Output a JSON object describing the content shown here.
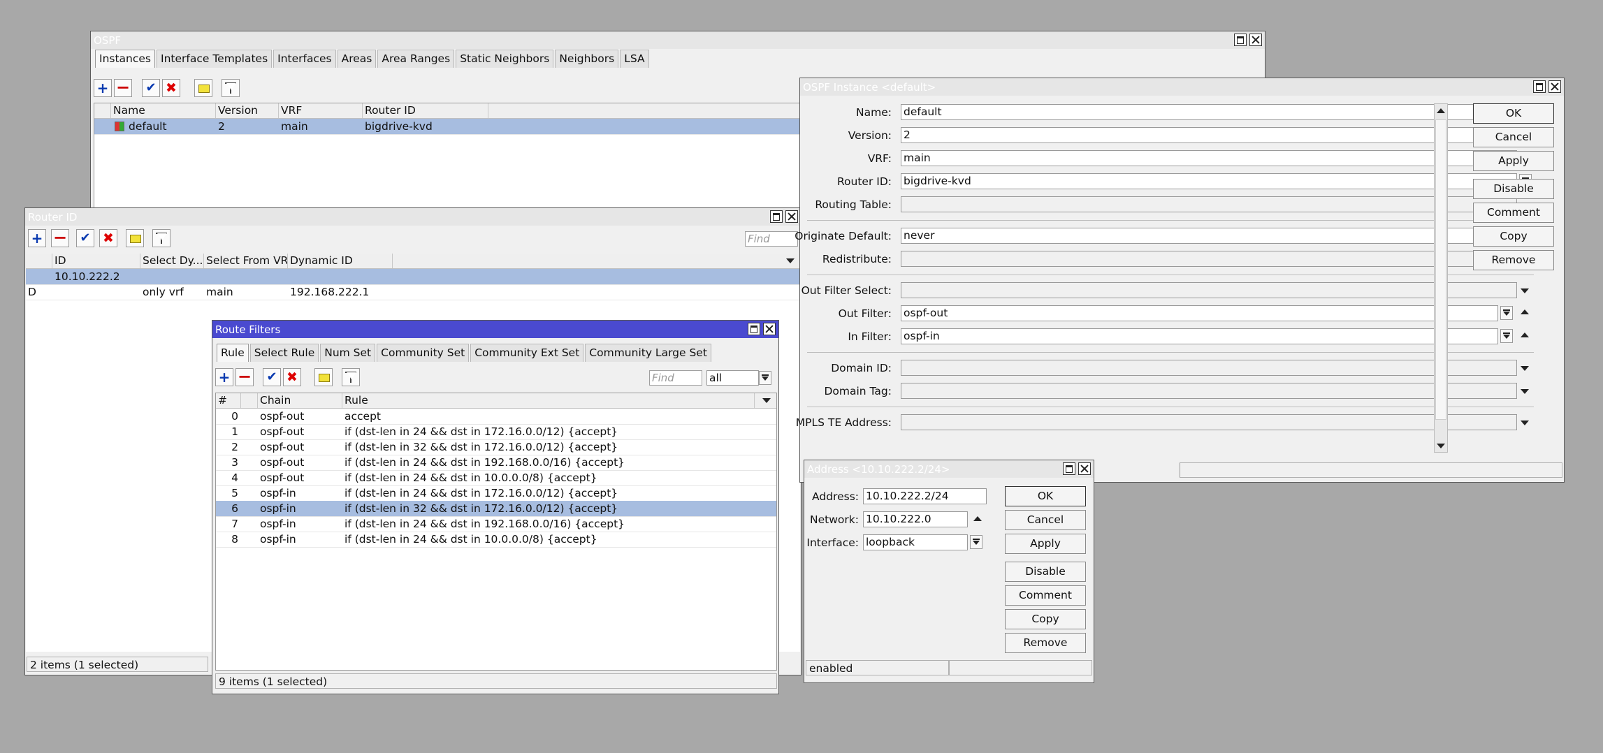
{
  "ospf": {
    "title": "OSPF",
    "tabs": [
      "Instances",
      "Interface Templates",
      "Interfaces",
      "Areas",
      "Area Ranges",
      "Static Neighbors",
      "Neighbors",
      "LSA"
    ],
    "columns": [
      "Name",
      "Version",
      "VRF",
      "Router ID"
    ],
    "rows": [
      {
        "name": "default",
        "version": "2",
        "vrf": "main",
        "router_id": "bigdrive-kvd"
      }
    ]
  },
  "router_id": {
    "title": "Router ID",
    "find_placeholder": "Find",
    "columns": [
      "ID",
      "Select Dy...",
      "Select From VRF",
      "Dynamic ID"
    ],
    "rows": [
      {
        "flag": "",
        "id": "10.10.222.2",
        "select_dy": "",
        "select_vrf": "",
        "dynamic_id": ""
      },
      {
        "flag": "D",
        "id": "",
        "select_dy": "only vrf",
        "select_vrf": "main",
        "dynamic_id": "192.168.222.1"
      }
    ],
    "status": "2 items (1 selected)"
  },
  "route_filters": {
    "title": "Route Filters",
    "tabs": [
      "Rule",
      "Select Rule",
      "Num Set",
      "Community Set",
      "Community Ext Set",
      "Community Large Set"
    ],
    "find_placeholder": "Find",
    "filter_value": "all",
    "columns": [
      "#",
      "Chain",
      "Rule"
    ],
    "rows": [
      {
        "num": "0",
        "chain": "ospf-out",
        "rule": "accept"
      },
      {
        "num": "1",
        "chain": "ospf-out",
        "rule": "if (dst-len in 24 && dst in 172.16.0.0/12) {accept}"
      },
      {
        "num": "2",
        "chain": "ospf-out",
        "rule": "if (dst-len in 32 && dst in 172.16.0.0/12) {accept}"
      },
      {
        "num": "3",
        "chain": "ospf-out",
        "rule": "if (dst-len in 24 && dst in 192.168.0.0/16) {accept}"
      },
      {
        "num": "4",
        "chain": "ospf-out",
        "rule": "if (dst-len in 24 && dst in 10.0.0.0/8) {accept}"
      },
      {
        "num": "5",
        "chain": "ospf-in",
        "rule": "if (dst-len in 24 && dst in 172.16.0.0/12) {accept}"
      },
      {
        "num": "6",
        "chain": "ospf-in",
        "rule": "if (dst-len in 32 && dst in 172.16.0.0/12) {accept}"
      },
      {
        "num": "7",
        "chain": "ospf-in",
        "rule": "if (dst-len in 24 && dst in 192.168.0.0/16) {accept}"
      },
      {
        "num": "8",
        "chain": "ospf-in",
        "rule": "if (dst-len in 24 && dst in 10.0.0.0/8) {accept}"
      }
    ],
    "status": "9 items (1 selected)"
  },
  "ospf_instance": {
    "title": "OSPF Instance <default>",
    "labels": {
      "name": "Name:",
      "version": "Version:",
      "vrf": "VRF:",
      "router_id": "Router ID:",
      "routing_table": "Routing Table:",
      "originate_default": "Originate Default:",
      "redistribute": "Redistribute:",
      "out_filter_select": "Out Filter Select:",
      "out_filter": "Out Filter:",
      "in_filter": "In Filter:",
      "domain_id": "Domain ID:",
      "domain_tag": "Domain Tag:",
      "mpls_te_address": "MPLS TE Address:"
    },
    "values": {
      "name": "default",
      "version": "2",
      "vrf": "main",
      "router_id": "bigdrive-kvd",
      "routing_table": "",
      "originate_default": "never",
      "redistribute": "",
      "out_filter_select": "",
      "out_filter": "ospf-out",
      "in_filter": "ospf-in",
      "domain_id": "",
      "domain_tag": "",
      "mpls_te_address": ""
    },
    "buttons": {
      "ok": "OK",
      "cancel": "Cancel",
      "apply": "Apply",
      "disable": "Disable",
      "comment": "Comment",
      "copy": "Copy",
      "remove": "Remove"
    }
  },
  "address": {
    "title": "Address <10.10.222.2/24>",
    "labels": {
      "address": "Address:",
      "network": "Network:",
      "interface": "Interface:"
    },
    "values": {
      "address": "10.10.222.2/24",
      "network": "10.10.222.0",
      "interface": "loopback"
    },
    "buttons": {
      "ok": "OK",
      "cancel": "Cancel",
      "apply": "Apply",
      "disable": "Disable",
      "comment": "Comment",
      "copy": "Copy",
      "remove": "Remove"
    },
    "status": "enabled"
  },
  "colors": {
    "desktop": "#a8a8a8",
    "active_title": "#4a4ad0",
    "selection": "#a7bde0"
  }
}
